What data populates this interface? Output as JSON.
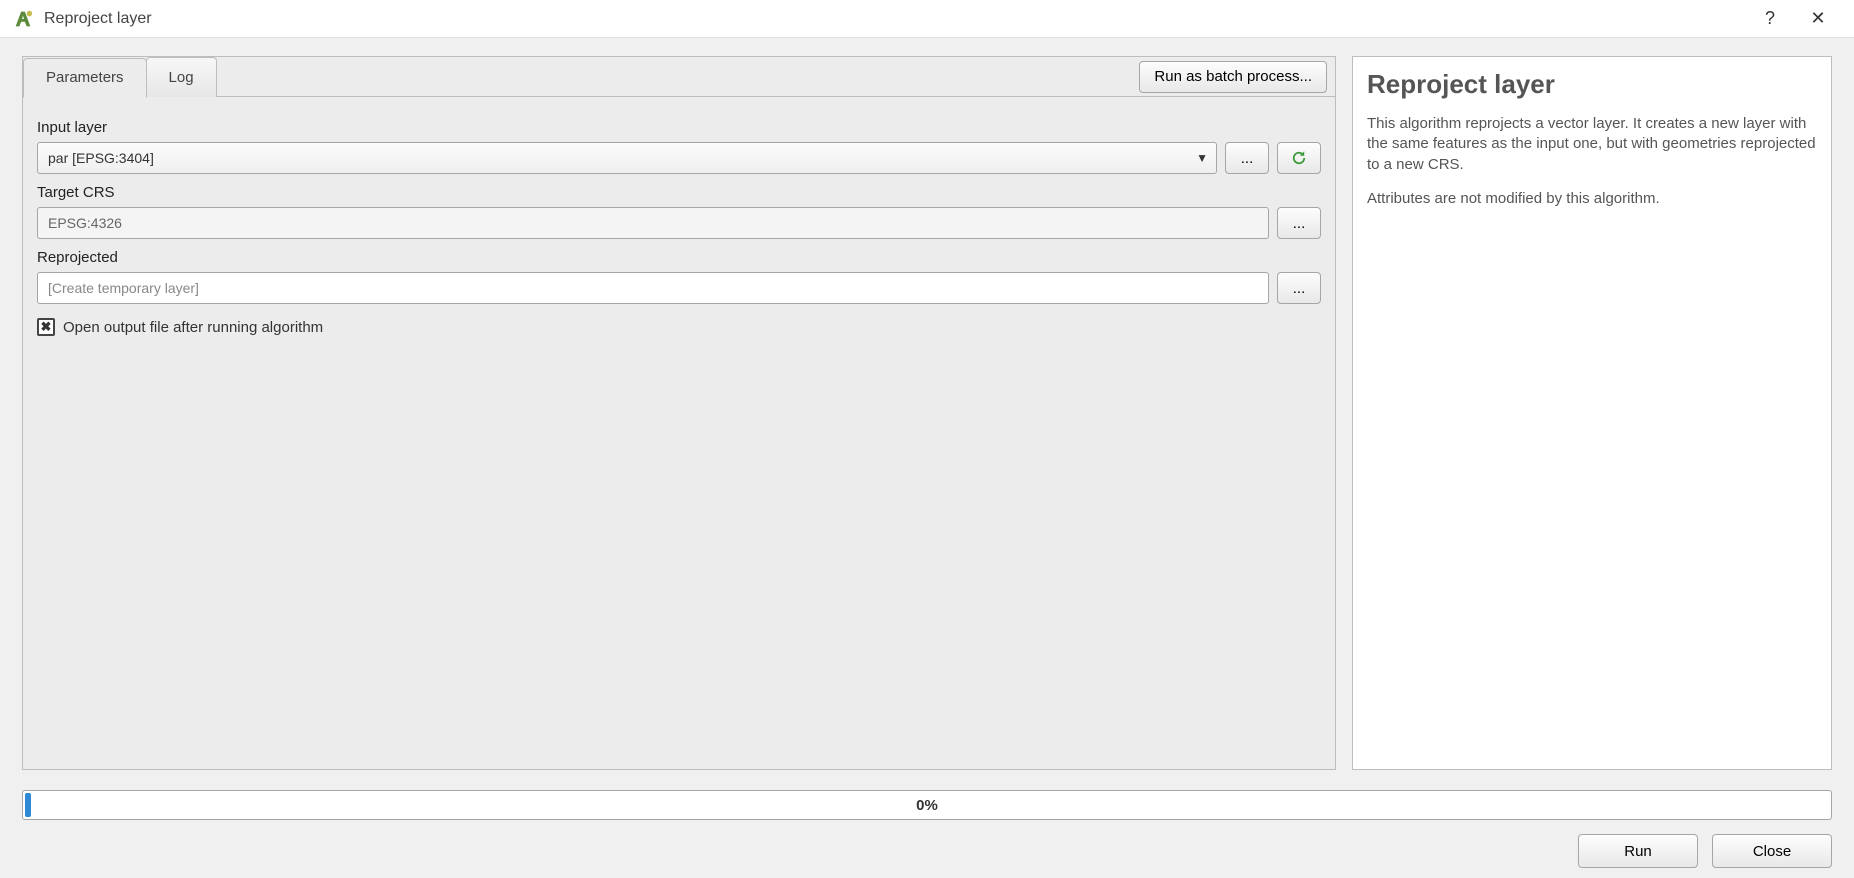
{
  "window": {
    "title": "Reproject layer",
    "help_symbol": "?",
    "close_symbol": "✕"
  },
  "tabs": {
    "parameters": "Parameters",
    "log": "Log"
  },
  "batch_button": "Run as batch process...",
  "form": {
    "input_layer": {
      "label": "Input layer",
      "value": "par [EPSG:3404]",
      "browse": "...",
      "reload_tooltip": "Reload"
    },
    "target_crs": {
      "label": "Target CRS",
      "value": "EPSG:4326",
      "browse": "..."
    },
    "reprojected": {
      "label": "Reprojected",
      "placeholder": "[Create temporary layer]",
      "browse": "..."
    },
    "open_output": {
      "label": "Open output file after running algorithm",
      "checked": true
    }
  },
  "help": {
    "title": "Reproject layer",
    "p1": "This algorithm reprojects a vector layer. It creates a new layer with the same features as the input one, but with geometries reprojected to a new CRS.",
    "p2": "Attributes are not modified by this algorithm."
  },
  "progress": {
    "percent_label": "0%"
  },
  "buttons": {
    "run": "Run",
    "close": "Close"
  }
}
